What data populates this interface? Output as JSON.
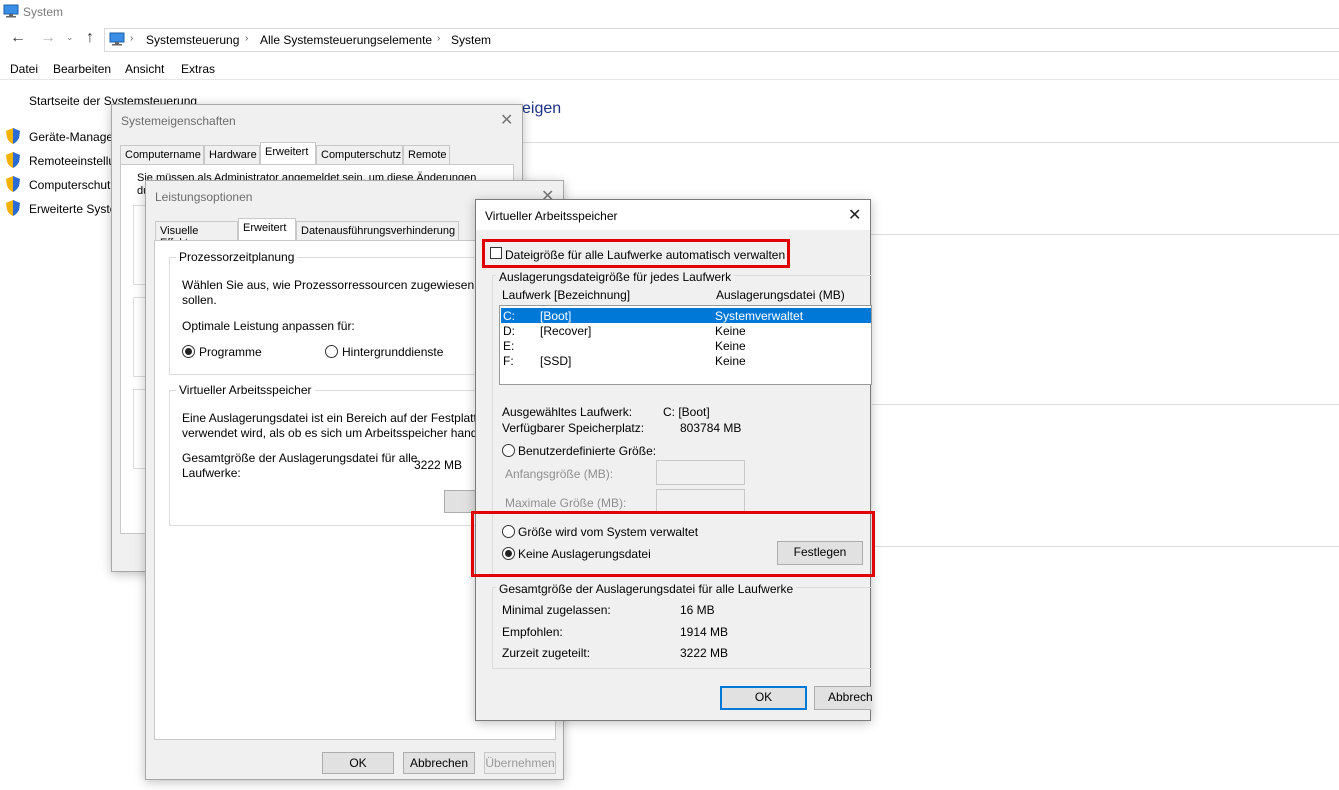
{
  "window": {
    "title": "System",
    "breadcrumb": [
      "Systemsteuerung",
      "Alle Systemsteuerungselemente",
      "System"
    ],
    "menu": [
      "Datei",
      "Bearbeiten",
      "Ansicht",
      "Extras"
    ],
    "sidebar": {
      "home": "Startseite der Systemsteuerung",
      "links": [
        "Geräte-Manage",
        "Remoteeinstellu",
        "Computerschut",
        "Erweiterte Syste"
      ]
    },
    "heading_fragment": "eigen"
  },
  "sysprops": {
    "title": "Systemeigenschaften",
    "tabs": [
      "Computername",
      "Hardware",
      "Erweitert",
      "Computerschutz",
      "Remote"
    ],
    "active_tab": "Erweitert",
    "admin_text_1": "Sie müssen als Administrator angemeldet sein, um diese Änderungen",
    "admin_text_2": "du"
  },
  "perf": {
    "title": "Leistungsoptionen",
    "tabs": [
      "Visuelle Effekte",
      "Erweitert",
      "Datenausführungsverhinderung"
    ],
    "active_tab": "Erweitert",
    "sched_group": "Prozessorzeitplanung",
    "sched_text_1": "Wählen Sie aus, wie Prozessorressourcen zugewiesen we",
    "sched_text_2": "sollen.",
    "optimize_label": "Optimale Leistung anpassen für:",
    "radio_programs": "Programme",
    "radio_background": "Hintergrunddienste",
    "vm_group": "Virtueller Arbeitsspeicher",
    "vm_text_1": "Eine Auslagerungsdatei ist ein Bereich auf der Festplatte",
    "vm_text_2": "verwendet wird, als ob es sich um Arbeitsspeicher hande",
    "vm_total_1": "Gesamtgröße der Auslagerungsdatei für alle",
    "vm_total_2": "Laufwerke:",
    "vm_total_value": "3222 MB",
    "change_button": "Än",
    "ok": "OK",
    "cancel": "Abbrechen",
    "apply": "Übernehmen"
  },
  "vm": {
    "title": "Virtueller Arbeitsspeicher",
    "auto_manage": "Dateigröße für alle Laufwerke automatisch verwalten",
    "auto_manage_checked": false,
    "per_drive_group": "Auslagerungsdateigröße für jedes Laufwerk",
    "col_drive": "Laufwerk [Bezeichnung]",
    "col_pagefile": "Auslagerungsdatei (MB)",
    "drives": [
      {
        "letter": "C:",
        "label": "[Boot]",
        "pagefile": "Systemverwaltet"
      },
      {
        "letter": "D:",
        "label": "[Recover]",
        "pagefile": "Keine"
      },
      {
        "letter": "E:",
        "label": "",
        "pagefile": "Keine"
      },
      {
        "letter": "F:",
        "label": "[SSD]",
        "pagefile": "Keine"
      }
    ],
    "selected_drive_label": "Ausgewähltes Laufwerk:",
    "selected_drive_value": "C:  [Boot]",
    "free_space_label": "Verfügbarer Speicherplatz:",
    "free_space_value": "803784 MB",
    "custom_size": "Benutzerdefinierte Größe:",
    "initial_size": "Anfangsgröße (MB):",
    "max_size": "Maximale Größe (MB):",
    "system_managed": "Größe wird vom System verwaltet",
    "no_pagefile": "Keine Auslagerungsdatei",
    "set_button": "Festlegen",
    "total_group": "Gesamtgröße der Auslagerungsdatei für alle Laufwerke",
    "min_allowed_label": "Minimal zugelassen:",
    "min_allowed_value": "16 MB",
    "recommended_label": "Empfohlen:",
    "recommended_value": "1914 MB",
    "allocated_label": "Zurzeit zugeteilt:",
    "allocated_value": "3222 MB",
    "ok": "OK",
    "cancel": "Abbrech"
  }
}
